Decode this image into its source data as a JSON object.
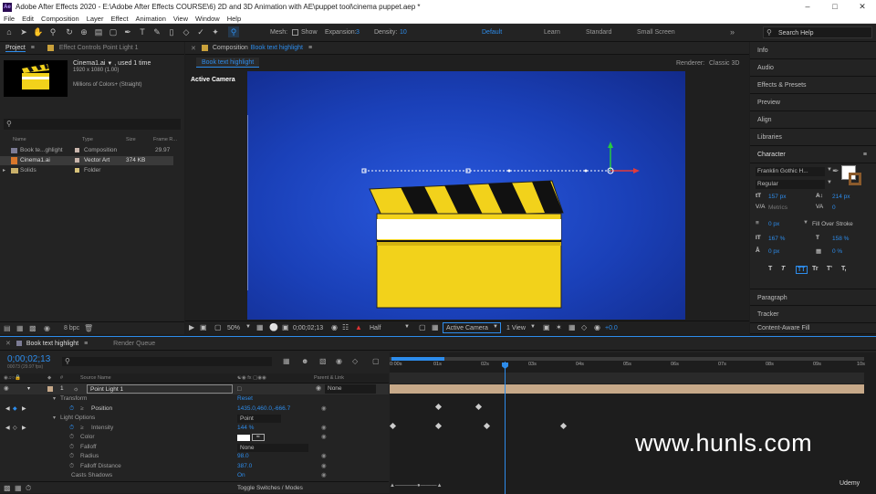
{
  "window": {
    "title": "Adobe After Effects 2020 - E:\\Adobe After Effects COURSE\\6) 2D and 3D Animation with AE\\puppet tool\\cinema puppet.aep *",
    "app_icon": "Ae",
    "controls": [
      "minimize-icon",
      "maximize-icon",
      "close-icon"
    ]
  },
  "menu": [
    "File",
    "Edit",
    "Composition",
    "Layer",
    "Effect",
    "Animation",
    "View",
    "Window",
    "Help"
  ],
  "toolbar": {
    "mesh_label": "Mesh:",
    "show_label": "Show",
    "expansion_label": "Expansion:",
    "expansion_value": "3",
    "density_label": "Density:",
    "density_value": "10",
    "workspaces": [
      "Default",
      "Learn",
      "Standard",
      "Small Screen"
    ],
    "active_workspace": "Default",
    "search_placeholder": "Search Help"
  },
  "project": {
    "tab_label": "Project",
    "effect_controls_label": "Effect Controls Point Light 1",
    "item_name": "Cinema1.ai",
    "item_used": ", used 1 time",
    "item_dims": "1920 x 1080 (1.00)",
    "item_colors": "Millions of Colors+ (Straight)",
    "columns": [
      "Name",
      "Type",
      "Size",
      "Frame R..."
    ],
    "rows": [
      {
        "name": "Book te...ghlight",
        "type": "Composition",
        "size": "",
        "fps": "29.97"
      },
      {
        "name": "Cinema1.ai",
        "type": "Vector Art",
        "size": "374 KB",
        "fps": ""
      },
      {
        "name": "Solids",
        "type": "Folder",
        "size": "",
        "fps": ""
      }
    ],
    "bpc": "8 bpc"
  },
  "composition": {
    "tab_label": "Composition",
    "comp_name": "Book text highlight",
    "breadcrumb": "Book text highlight",
    "renderer_label": "Renderer:",
    "renderer_value": "Classic 3D",
    "camera_label": "Active Camera",
    "zoom": "50%",
    "timecode": "0;00;02;13",
    "resolution": "Half",
    "view": "Active Camera",
    "views": "1 View",
    "exposure": "+0.0"
  },
  "right_panels": [
    "Info",
    "Audio",
    "Effects & Presets",
    "Preview",
    "Align",
    "Libraries"
  ],
  "character": {
    "title": "Character",
    "font": "Franklin Gothic H...",
    "style": "Regular",
    "size": "157 px",
    "leading": "214 px",
    "kerning": "Metrics",
    "tracking": "0",
    "stroke_width": "0 px",
    "stroke_type": "Fill Over Stroke",
    "vert_scale": "167 %",
    "horiz_scale": "158 %",
    "baseline": "0 px",
    "tsume": "0 %",
    "styles": [
      "T",
      "T",
      "TT",
      "Tr",
      "T'",
      "T,"
    ]
  },
  "bottom_panels": [
    "Paragraph",
    "Tracker",
    "Content-Aware Fill"
  ],
  "timeline": {
    "tab_label": "Book text highlight",
    "render_queue": "Render Queue",
    "timecode": "0;00;02;13",
    "frame_info": "00073 (29.97 fps)",
    "col_source": "Source Name",
    "col_parent": "Parent & Link",
    "layer_num": "1",
    "layer_name": "Point Light 1",
    "parent_value": "None",
    "properties": [
      {
        "label": "Transform",
        "value": "Reset"
      },
      {
        "label": "Position",
        "value": "1435.0,460.0,-666.7"
      },
      {
        "label": "Light Options",
        "value": "Point"
      },
      {
        "label": "Intensity",
        "value": "144 %"
      },
      {
        "label": "Color",
        "value": ""
      },
      {
        "label": "Falloff",
        "value": "None"
      },
      {
        "label": "Radius",
        "value": "98.0"
      },
      {
        "label": "Falloff Distance",
        "value": "387.0"
      },
      {
        "label": "Casts Shadows",
        "value": "On"
      }
    ],
    "ruler": [
      "0:00s",
      "01s",
      "02s",
      "03s",
      "04s",
      "05s",
      "06s",
      "07s",
      "08s",
      "09s",
      "10s"
    ],
    "toggle_label": "Toggle Switches / Modes"
  },
  "watermark": "www.hunls.com",
  "udemy": "Udemy",
  "colors": {
    "accent": "#2d8ceb",
    "comp_bg": "#1a40b8",
    "clapper_yellow": "#f2d21b",
    "layer_bar": "#c7a989"
  }
}
